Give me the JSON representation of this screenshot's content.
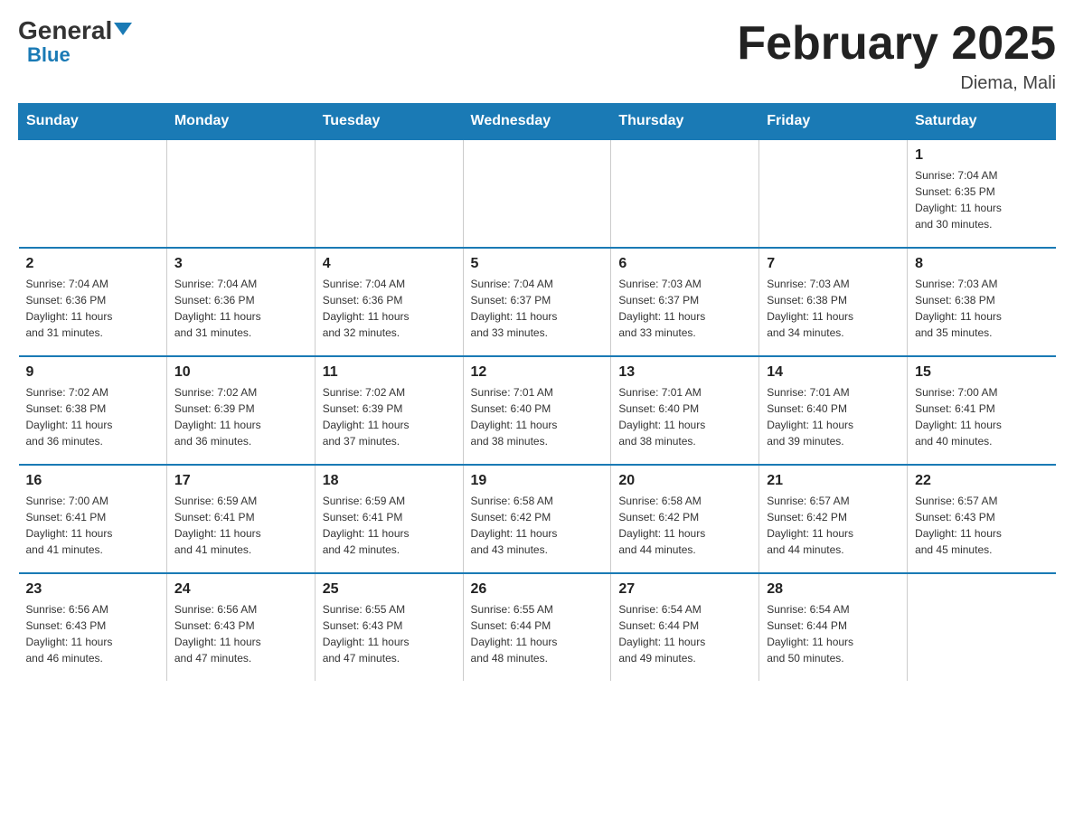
{
  "header": {
    "logo_general": "General",
    "logo_blue": "Blue",
    "title": "February 2025",
    "subtitle": "Diema, Mali"
  },
  "days_of_week": [
    "Sunday",
    "Monday",
    "Tuesday",
    "Wednesday",
    "Thursday",
    "Friday",
    "Saturday"
  ],
  "weeks": [
    {
      "cells": [
        {
          "day": null,
          "info": ""
        },
        {
          "day": null,
          "info": ""
        },
        {
          "day": null,
          "info": ""
        },
        {
          "day": null,
          "info": ""
        },
        {
          "day": null,
          "info": ""
        },
        {
          "day": null,
          "info": ""
        },
        {
          "day": "1",
          "info": "Sunrise: 7:04 AM\nSunset: 6:35 PM\nDaylight: 11 hours\nand 30 minutes."
        }
      ]
    },
    {
      "cells": [
        {
          "day": "2",
          "info": "Sunrise: 7:04 AM\nSunset: 6:36 PM\nDaylight: 11 hours\nand 31 minutes."
        },
        {
          "day": "3",
          "info": "Sunrise: 7:04 AM\nSunset: 6:36 PM\nDaylight: 11 hours\nand 31 minutes."
        },
        {
          "day": "4",
          "info": "Sunrise: 7:04 AM\nSunset: 6:36 PM\nDaylight: 11 hours\nand 32 minutes."
        },
        {
          "day": "5",
          "info": "Sunrise: 7:04 AM\nSunset: 6:37 PM\nDaylight: 11 hours\nand 33 minutes."
        },
        {
          "day": "6",
          "info": "Sunrise: 7:03 AM\nSunset: 6:37 PM\nDaylight: 11 hours\nand 33 minutes."
        },
        {
          "day": "7",
          "info": "Sunrise: 7:03 AM\nSunset: 6:38 PM\nDaylight: 11 hours\nand 34 minutes."
        },
        {
          "day": "8",
          "info": "Sunrise: 7:03 AM\nSunset: 6:38 PM\nDaylight: 11 hours\nand 35 minutes."
        }
      ]
    },
    {
      "cells": [
        {
          "day": "9",
          "info": "Sunrise: 7:02 AM\nSunset: 6:38 PM\nDaylight: 11 hours\nand 36 minutes."
        },
        {
          "day": "10",
          "info": "Sunrise: 7:02 AM\nSunset: 6:39 PM\nDaylight: 11 hours\nand 36 minutes."
        },
        {
          "day": "11",
          "info": "Sunrise: 7:02 AM\nSunset: 6:39 PM\nDaylight: 11 hours\nand 37 minutes."
        },
        {
          "day": "12",
          "info": "Sunrise: 7:01 AM\nSunset: 6:40 PM\nDaylight: 11 hours\nand 38 minutes."
        },
        {
          "day": "13",
          "info": "Sunrise: 7:01 AM\nSunset: 6:40 PM\nDaylight: 11 hours\nand 38 minutes."
        },
        {
          "day": "14",
          "info": "Sunrise: 7:01 AM\nSunset: 6:40 PM\nDaylight: 11 hours\nand 39 minutes."
        },
        {
          "day": "15",
          "info": "Sunrise: 7:00 AM\nSunset: 6:41 PM\nDaylight: 11 hours\nand 40 minutes."
        }
      ]
    },
    {
      "cells": [
        {
          "day": "16",
          "info": "Sunrise: 7:00 AM\nSunset: 6:41 PM\nDaylight: 11 hours\nand 41 minutes."
        },
        {
          "day": "17",
          "info": "Sunrise: 6:59 AM\nSunset: 6:41 PM\nDaylight: 11 hours\nand 41 minutes."
        },
        {
          "day": "18",
          "info": "Sunrise: 6:59 AM\nSunset: 6:41 PM\nDaylight: 11 hours\nand 42 minutes."
        },
        {
          "day": "19",
          "info": "Sunrise: 6:58 AM\nSunset: 6:42 PM\nDaylight: 11 hours\nand 43 minutes."
        },
        {
          "day": "20",
          "info": "Sunrise: 6:58 AM\nSunset: 6:42 PM\nDaylight: 11 hours\nand 44 minutes."
        },
        {
          "day": "21",
          "info": "Sunrise: 6:57 AM\nSunset: 6:42 PM\nDaylight: 11 hours\nand 44 minutes."
        },
        {
          "day": "22",
          "info": "Sunrise: 6:57 AM\nSunset: 6:43 PM\nDaylight: 11 hours\nand 45 minutes."
        }
      ]
    },
    {
      "cells": [
        {
          "day": "23",
          "info": "Sunrise: 6:56 AM\nSunset: 6:43 PM\nDaylight: 11 hours\nand 46 minutes."
        },
        {
          "day": "24",
          "info": "Sunrise: 6:56 AM\nSunset: 6:43 PM\nDaylight: 11 hours\nand 47 minutes."
        },
        {
          "day": "25",
          "info": "Sunrise: 6:55 AM\nSunset: 6:43 PM\nDaylight: 11 hours\nand 47 minutes."
        },
        {
          "day": "26",
          "info": "Sunrise: 6:55 AM\nSunset: 6:44 PM\nDaylight: 11 hours\nand 48 minutes."
        },
        {
          "day": "27",
          "info": "Sunrise: 6:54 AM\nSunset: 6:44 PM\nDaylight: 11 hours\nand 49 minutes."
        },
        {
          "day": "28",
          "info": "Sunrise: 6:54 AM\nSunset: 6:44 PM\nDaylight: 11 hours\nand 50 minutes."
        },
        {
          "day": null,
          "info": ""
        }
      ]
    }
  ]
}
